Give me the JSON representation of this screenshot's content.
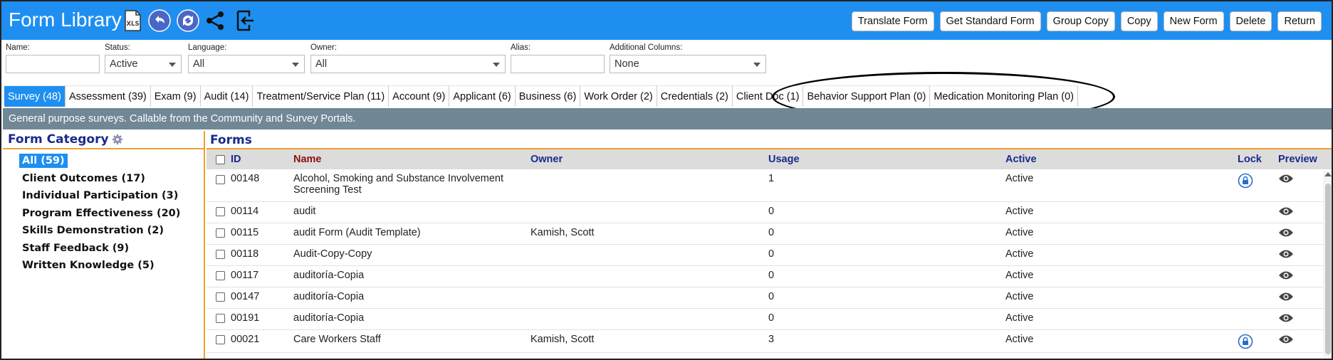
{
  "header": {
    "title": "Form Library",
    "buttons": [
      "Translate Form",
      "Get Standard Form",
      "Group Copy",
      "Copy",
      "New Form",
      "Delete",
      "Return"
    ]
  },
  "filters": {
    "name_label": "Name:",
    "name_value": "",
    "status_label": "Status:",
    "status_value": "Active",
    "language_label": "Language:",
    "language_value": "All",
    "owner_label": "Owner:",
    "owner_value": "All",
    "alias_label": "Alias:",
    "alias_value": "",
    "additional_label": "Additional Columns:",
    "additional_value": "None"
  },
  "tabs": [
    "Survey (48)",
    "Assessment (39)",
    "Exam (9)",
    "Audit (14)",
    "Treatment/Service Plan (11)",
    "Account (9)",
    "Applicant (6)",
    "Business (6)",
    "Work Order (2)",
    "Credentials (2)",
    "Client Doc (1)",
    "Behavior Support Plan (0)",
    "Medication Monitoring Plan (0)"
  ],
  "description": "General purpose surveys. Callable from the Community and Survey Portals.",
  "category_panel": {
    "title": "Form Category",
    "items": [
      "All (59)",
      "Client Outcomes (17)",
      "Individual Participation (3)",
      "Program Effectiveness (20)",
      "Skills Demonstration (2)",
      "Staff Feedback (9)",
      "Written Knowledge (5)"
    ]
  },
  "forms": {
    "title": "Forms",
    "columns": {
      "id": "ID",
      "name": "Name",
      "owner": "Owner",
      "usage": "Usage",
      "active": "Active",
      "lock": "Lock",
      "preview": "Preview"
    },
    "rows": [
      {
        "id": "00148",
        "name": "Alcohol, Smoking and Substance Involvement",
        "name2": "Screening Test",
        "owner": "",
        "usage": "1",
        "active": "Active",
        "locked": true
      },
      {
        "id": "00114",
        "name": "audit",
        "owner": "",
        "usage": "0",
        "active": "Active",
        "locked": false
      },
      {
        "id": "00115",
        "name": "audit Form (Audit Template)",
        "owner": "Kamish, Scott",
        "usage": "0",
        "active": "Active",
        "locked": false
      },
      {
        "id": "00118",
        "name": "Audit-Copy-Copy",
        "owner": "",
        "usage": "0",
        "active": "Active",
        "locked": false
      },
      {
        "id": "00117",
        "name": "auditoría-Copia",
        "owner": "",
        "usage": "0",
        "active": "Active",
        "locked": false
      },
      {
        "id": "00147",
        "name": "auditoría-Copia",
        "owner": "",
        "usage": "0",
        "active": "Active",
        "locked": false
      },
      {
        "id": "00191",
        "name": "auditoría-Copia",
        "owner": "",
        "usage": "0",
        "active": "Active",
        "locked": false
      },
      {
        "id": "00021",
        "name": "Care Workers Staff",
        "owner": "Kamish, Scott",
        "usage": "3",
        "active": "Active",
        "locked": true
      }
    ]
  },
  "colors": {
    "header_blue": "#1e8ff0",
    "accent_orange": "#f0a030",
    "desc_bar": "#708796",
    "title_navy": "#1a2a8a",
    "name_header": "#8b1010"
  }
}
